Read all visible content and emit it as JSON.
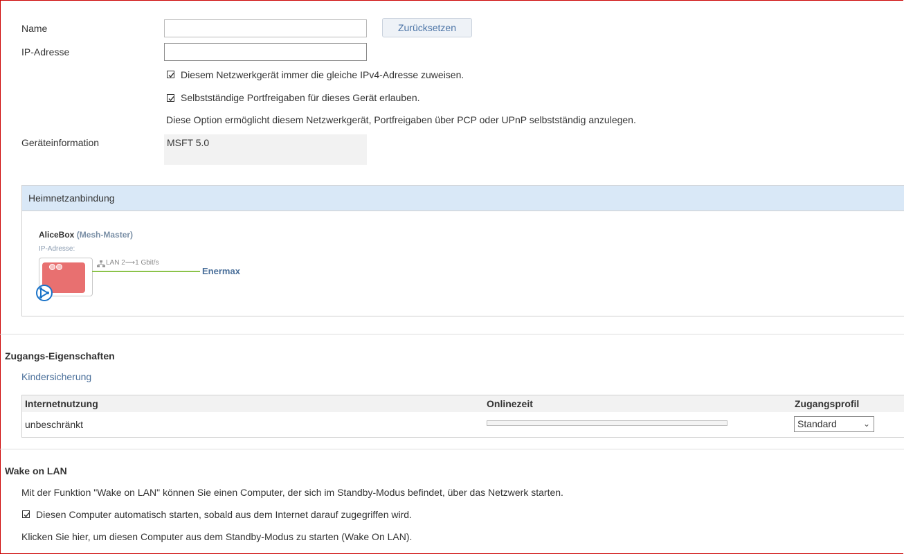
{
  "form": {
    "name_label": "Name",
    "name_value": "",
    "reset_button": "Zurücksetzen",
    "ip_label": "IP-Adresse",
    "ip_value": "",
    "checkbox_fixed_ip": "Diesem Netzwerkgerät immer die gleiche IPv4-Adresse zuweisen.",
    "checkbox_portfw": "Selbstständige Portfreigaben für dieses Gerät erlauben.",
    "portfw_hint": "Diese Option ermöglicht diesem Netzwerkgerät, Portfreigaben über PCP oder UPnP selbstständig anzulegen.",
    "devinfo_label": "Geräteinformation",
    "devinfo_value": "MSFT 5.0"
  },
  "heimnetz": {
    "title": "Heimnetzanbindung",
    "router_name": "AliceBox",
    "router_role": "(Mesh-Master)",
    "ip_label": "IP-Adresse:",
    "link_label": "LAN 2⟶1 Gbit/s",
    "device_name": "Enermax",
    "colors": {
      "router": "#e87070",
      "link": "#8bc34a",
      "mesh": "#1a73c8"
    }
  },
  "access": {
    "title": "Zugangs-Eigenschaften",
    "parental_link": "Kindersicherung",
    "columns": [
      "Internetnutzung",
      "Onlinezeit",
      "Zugangsprofil"
    ],
    "usage_value": "unbeschränkt",
    "online_time_fraction": 0,
    "profile_value": "Standard"
  },
  "wol": {
    "title": "Wake on LAN",
    "description": "Mit der Funktion \"Wake on LAN\" können Sie einen Computer, der sich im Standby-Modus befindet, über das Netzwerk starten.",
    "checkbox_auto": "Diesen Computer automatisch starten, sobald aus dem Internet darauf zugegriffen wird.",
    "start_hint": "Klicken Sie hier, um diesen Computer aus dem Standby-Modus zu starten (Wake On LAN)."
  }
}
